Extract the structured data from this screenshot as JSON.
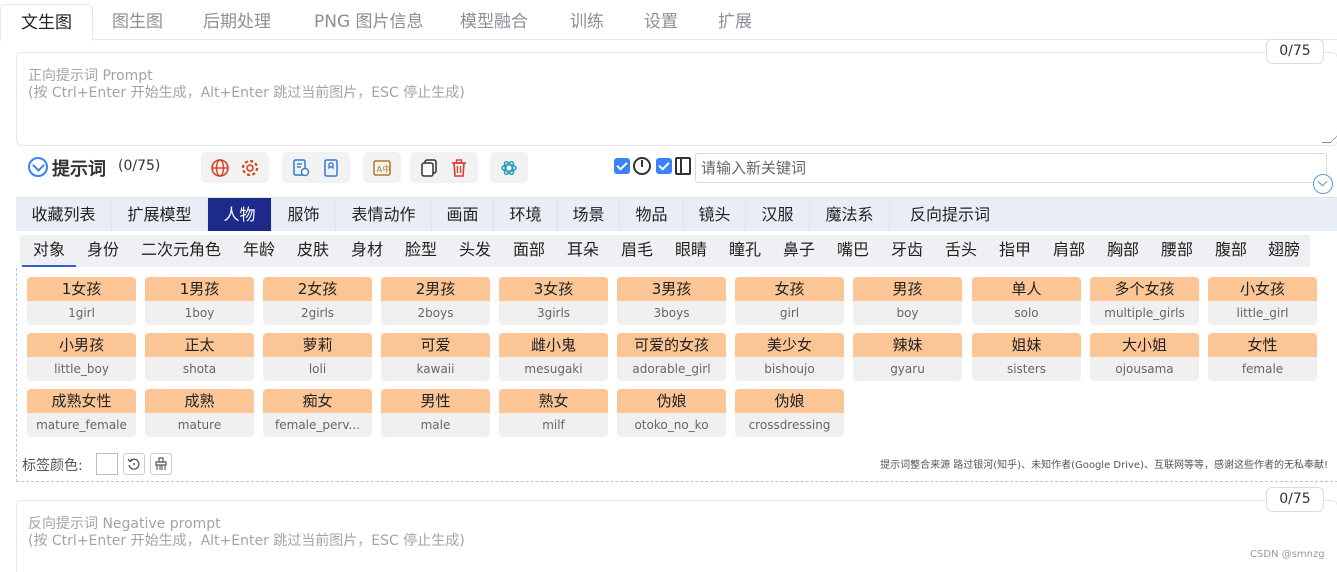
{
  "top_tabs": [
    "文生图",
    "图生图",
    "后期处理",
    "PNG 图片信息",
    "模型融合",
    "训练",
    "设置",
    "扩展"
  ],
  "prompt": {
    "placeholder_line1": "正向提示词 Prompt",
    "placeholder_line2": "(按 Ctrl+Enter 开始生成，Alt+Enter 跳过当前图片，ESC 停止生成)",
    "counter": "0/75"
  },
  "toolbar": {
    "title": "提示词",
    "count": "(0/75)",
    "icons": [
      "globe-icon",
      "settings-icon",
      "history-icon",
      "bookmark-icon",
      "translate-icon",
      "copy-icon",
      "delete-icon",
      "openai-icon"
    ],
    "keyword_placeholder": "请输入新关键词"
  },
  "categories": [
    "收藏列表",
    "扩展模型",
    "人物",
    "服饰",
    "表情动作",
    "画面",
    "环境",
    "场景",
    "物品",
    "镜头",
    "汉服",
    "魔法系",
    "反向提示词"
  ],
  "active_category": "人物",
  "subcategories": [
    "对象",
    "身份",
    "二次元角色",
    "年龄",
    "皮肤",
    "身材",
    "脸型",
    "头发",
    "面部",
    "耳朵",
    "眉毛",
    "眼睛",
    "瞳孔",
    "鼻子",
    "嘴巴",
    "牙齿",
    "舌头",
    "指甲",
    "肩部",
    "胸部",
    "腰部",
    "腹部",
    "翅膀"
  ],
  "active_subcategory": "对象",
  "tags": [
    {
      "zh": "1女孩",
      "en": "1girl"
    },
    {
      "zh": "1男孩",
      "en": "1boy"
    },
    {
      "zh": "2女孩",
      "en": "2girls"
    },
    {
      "zh": "2男孩",
      "en": "2boys"
    },
    {
      "zh": "3女孩",
      "en": "3girls"
    },
    {
      "zh": "3男孩",
      "en": "3boys"
    },
    {
      "zh": "女孩",
      "en": "girl"
    },
    {
      "zh": "男孩",
      "en": "boy"
    },
    {
      "zh": "单人",
      "en": "solo"
    },
    {
      "zh": "多个女孩",
      "en": "multiple_girls"
    },
    {
      "zh": "小女孩",
      "en": "little_girl"
    },
    {
      "zh": "小男孩",
      "en": "little_boy"
    },
    {
      "zh": "正太",
      "en": "shota"
    },
    {
      "zh": "萝莉",
      "en": "loli"
    },
    {
      "zh": "可爱",
      "en": "kawaii"
    },
    {
      "zh": "雌小鬼",
      "en": "mesugaki"
    },
    {
      "zh": "可爱的女孩",
      "en": "adorable_girl"
    },
    {
      "zh": "美少女",
      "en": "bishoujo"
    },
    {
      "zh": "辣妹",
      "en": "gyaru"
    },
    {
      "zh": "姐妹",
      "en": "sisters"
    },
    {
      "zh": "大小姐",
      "en": "ojousama"
    },
    {
      "zh": "女性",
      "en": "female"
    },
    {
      "zh": "成熟女性",
      "en": "mature_female"
    },
    {
      "zh": "成熟",
      "en": "mature"
    },
    {
      "zh": "痴女",
      "en": "female_perv..."
    },
    {
      "zh": "男性",
      "en": "male"
    },
    {
      "zh": "熟女",
      "en": "milf"
    },
    {
      "zh": "伪娘",
      "en": "otoko_no_ko"
    },
    {
      "zh": "伪娘",
      "en": "crossdressing"
    }
  ],
  "footer": {
    "color_label": "标签颜色:",
    "credits": "提示词整合来源 路过银河(知乎)、未知作者(Google Drive)、互联网等等，感谢这些作者的无私奉献!"
  },
  "negative": {
    "placeholder_line1": "反向提示词 Negative prompt",
    "placeholder_line2": "(按 Ctrl+Enter 开始生成，Alt+Enter 跳过当前图片，ESC 停止生成)",
    "counter": "0/75"
  },
  "watermark": "CSDN @smnzg",
  "colors": {
    "accent": "#1e2a8a",
    "tag_bg": "#fcc595",
    "checkbox": "#3b82f6"
  }
}
